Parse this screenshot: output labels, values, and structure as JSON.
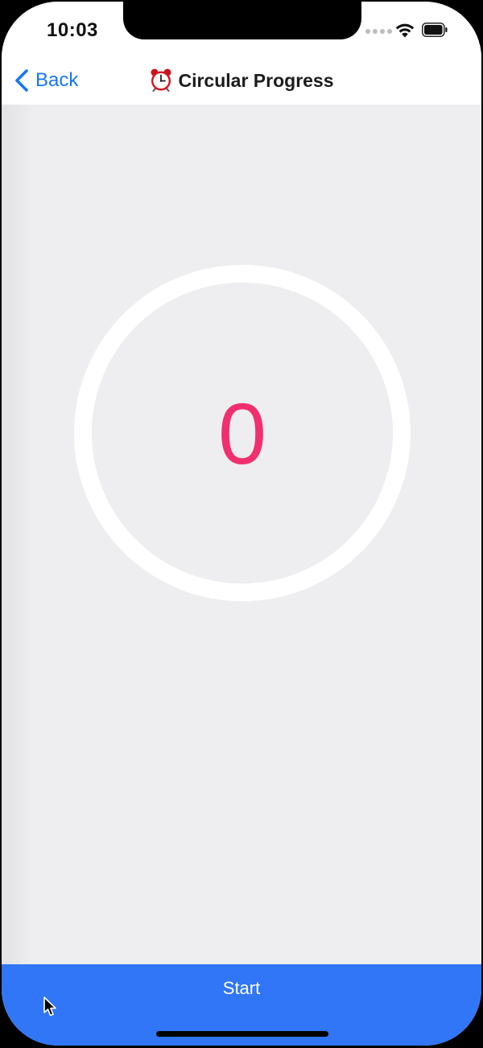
{
  "status_bar": {
    "time": "10:03",
    "icons": [
      "signal-dots-icon",
      "wifi-icon",
      "battery-icon"
    ]
  },
  "nav": {
    "back_label": "Back",
    "title": "Circular Progress",
    "title_icon": "alarm-clock-icon"
  },
  "progress": {
    "value": "0",
    "fraction": 0
  },
  "footer": {
    "start_label": "Start"
  },
  "colors": {
    "accent": "#1577f3",
    "progress_text": "#f12f6e",
    "button": "#3076f6",
    "background": "#eeedef"
  }
}
